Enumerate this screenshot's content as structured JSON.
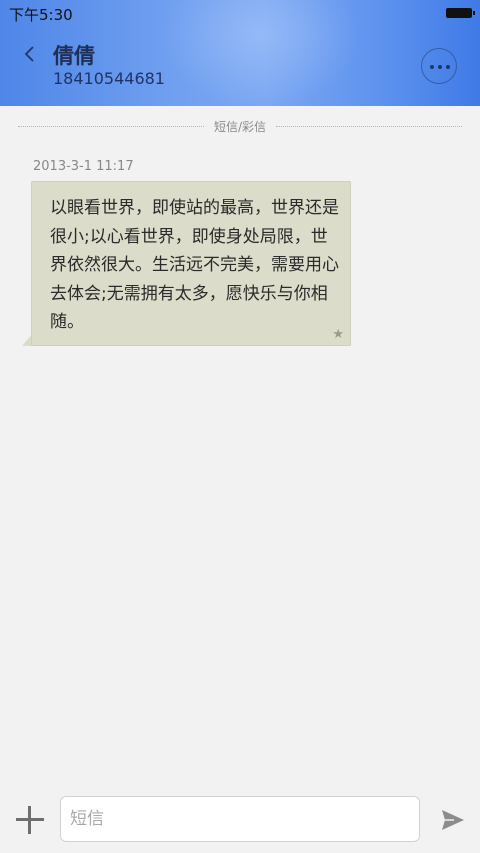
{
  "status_bar": {
    "time": "下午5:30",
    "battery_icon": "battery-icon"
  },
  "header": {
    "back_icon": "chevron-left-icon",
    "contact_name": "倩倩",
    "contact_number": "18410544681",
    "more_icon": "more-dots-icon"
  },
  "conversation": {
    "type_label": "短信/彩信",
    "messages": [
      {
        "timestamp": "2013-3-1 11:17",
        "text": "以眼看世界，即使站的最高，世界还是很小;以心看世界，即使身处局限，世界依然很大。生活远不完美，需要用心去体会;无需拥有太多，愿快乐与你相随。",
        "starred": true
      }
    ]
  },
  "input_bar": {
    "add_icon": "plus-icon",
    "placeholder": "短信",
    "value": "",
    "send_icon": "send-icon"
  },
  "colors": {
    "header_accent": "#5b90ee",
    "bubble_background": "#dcdccb",
    "page_background": "#f2f2f2"
  }
}
